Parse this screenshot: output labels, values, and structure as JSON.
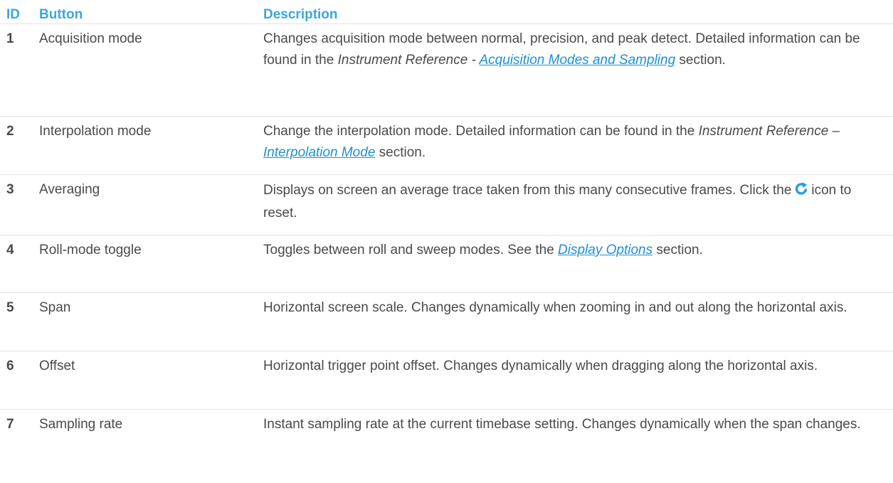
{
  "header": {
    "id": "ID",
    "button": "Button",
    "description": "Description"
  },
  "rows": [
    {
      "id": "1",
      "button": "Acquisition mode",
      "desc": {
        "part1": "Changes acquisition mode between normal, precision, and peak detect. Detailed information can be found in the ",
        "em1": "Instrument Reference - ",
        "link1": "Acquisition Modes and Sampling",
        "part2": " section."
      }
    },
    {
      "id": "2",
      "button": "Interpolation mode",
      "desc": {
        "part1": "Change the interpolation mode. Detailed information can be found in the ",
        "em1": "Instrument Reference – ",
        "link1": "Interpolation Mode",
        "part2": " section."
      }
    },
    {
      "id": "3",
      "button": "Averaging",
      "desc": {
        "part1": "Displays on screen an average trace taken from this many consecutive frames. Click the",
        "icon": "refresh-icon",
        "part2": "icon to reset."
      }
    },
    {
      "id": "4",
      "button": "Roll-mode toggle",
      "desc": {
        "part1": "Toggles between roll and sweep modes. See the ",
        "link1": "Display Options",
        "part2": " section."
      }
    },
    {
      "id": "5",
      "button": "Span",
      "desc": {
        "text": "Horizontal screen scale. Changes dynamically when zooming in and out along the horizontal axis."
      }
    },
    {
      "id": "6",
      "button": "Offset",
      "desc": {
        "text": "Horizontal trigger point offset. Changes dynamically when dragging along the horizontal axis."
      }
    },
    {
      "id": "7",
      "button": "Sampling rate",
      "desc": {
        "text": "Instant sampling rate at the current timebase setting. Changes dynamically when the span changes."
      }
    }
  ],
  "colors": {
    "header": "#3aa7e0",
    "link": "#1e8fd4",
    "text": "#4a4a4a",
    "divider": "#e2e2e2"
  }
}
